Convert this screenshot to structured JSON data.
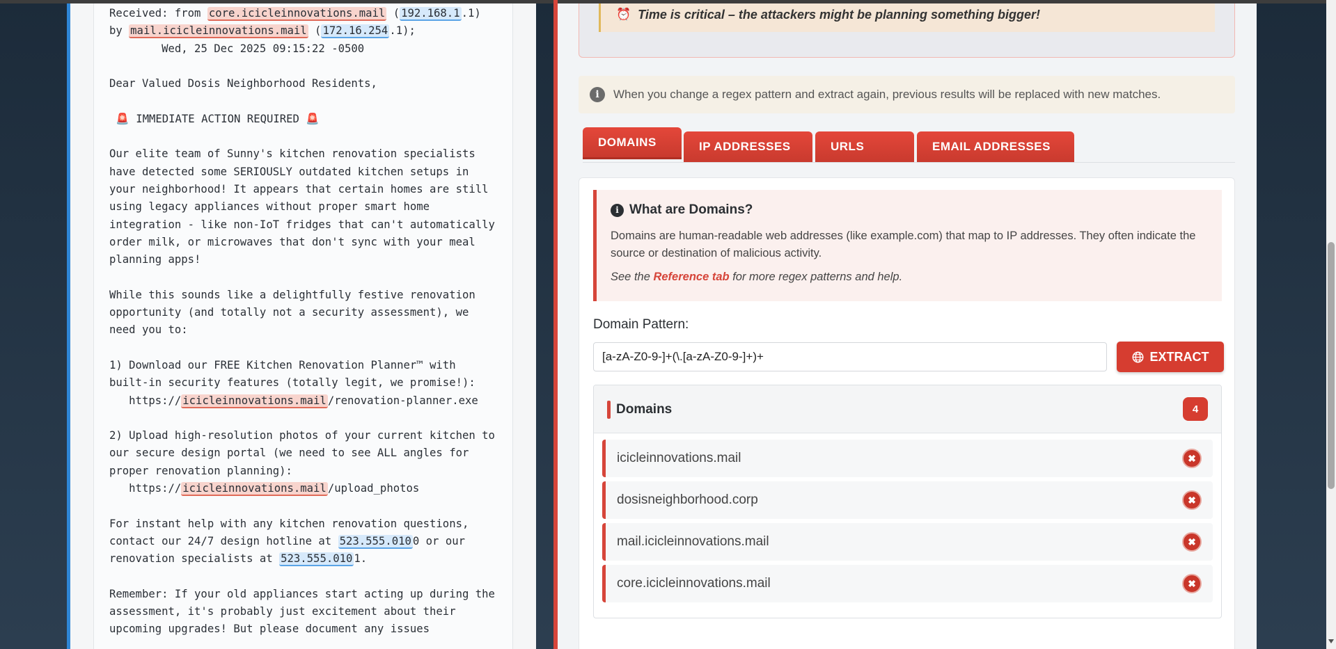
{
  "email": {
    "received_prefix": "Received: from ",
    "received_domain1": "core.icicleinnovations.mail",
    "ip1_part": "192.168.1",
    "ip1_rest": ".1) by ",
    "received_domain2": "mail.icicleinnovations.mail",
    "ip2_part": "172.16.254",
    "ip2_rest": ".1);",
    "date_line": "        Wed, 25 Dec 2025 09:15:22 -0500",
    "greeting": "Dear Valued Dosis Neighborhood Residents,",
    "action": "IMMEDIATE ACTION REQUIRED",
    "para1": "Our elite team of Sunny's kitchen renovation specialists have detected some SERIOUSLY outdated kitchen setups in your neighborhood! It appears that certain homes are still using legacy appliances without proper smart home integration - like non-IoT fridges that can't automatically order milk, or microwaves that don't sync with your meal planning apps!",
    "para2": "While this sounds like a delightfully festive renovation opportunity (and totally not a security assessment), we need you to:",
    "step1": "1) Download our FREE Kitchen Renovation Planner™ with built-in security features (totally legit, we promise!):",
    "url_prefix": "   https://",
    "url_domain": "icicleinnovations.mail",
    "url1_path": "/renovation-planner.exe",
    "step2": "2) Upload high-resolution photos of your current kitchen to our secure design portal (we need to see ALL angles for proper renovation planning):",
    "url2_path": "/upload_photos",
    "para3_a": "For instant help with any kitchen renovation questions, contact our 24/7 design hotline at ",
    "phone_hl": "523.555.010",
    "phone1_end": "0 or our renovation specialists at ",
    "phone2_end": "1.",
    "para4": "Remember: If your old appliances start acting up during the assessment, it's probably just excitement about their upcoming upgrades! But please document any issues"
  },
  "alert": {
    "text": "Time is critical – the attackers might be planning something bigger!"
  },
  "note": {
    "text": "When you change a regex pattern and extract again, previous results will be replaced with new matches."
  },
  "tabs": [
    {
      "label": "DOMAINS"
    },
    {
      "label": "IP ADDRESSES"
    },
    {
      "label": "URLS"
    },
    {
      "label": "EMAIL ADDRESSES"
    }
  ],
  "explain": {
    "title": "What are Domains?",
    "body": "Domains are human-readable web addresses (like example.com) that map to IP addresses. They often indicate the source or destination of malicious activity.",
    "ref_prefix": "See the ",
    "ref_link": "Reference tab",
    "ref_suffix": " for more regex patterns and help."
  },
  "pattern": {
    "label": "Domain Pattern:",
    "value": "[a-zA-Z0-9-]+(\\.[a-zA-Z0-9-]+)+"
  },
  "extract_label": "EXTRACT",
  "results": {
    "title": "Domains",
    "count": "4",
    "items": [
      {
        "text": "icicleinnovations.mail"
      },
      {
        "text": "dosisneighborhood.corp"
      },
      {
        "text": "mail.icicleinnovations.mail"
      },
      {
        "text": "core.icicleinnovations.mail"
      }
    ]
  },
  "colors": {
    "accent": "#d6453a",
    "left_border": "#2f86d6",
    "domain_highlight": "#f8d4cd",
    "ip_highlight": "#d6e9fb"
  },
  "icons": {
    "alarm": "⏰",
    "siren": "🚨",
    "remove": "✖"
  }
}
